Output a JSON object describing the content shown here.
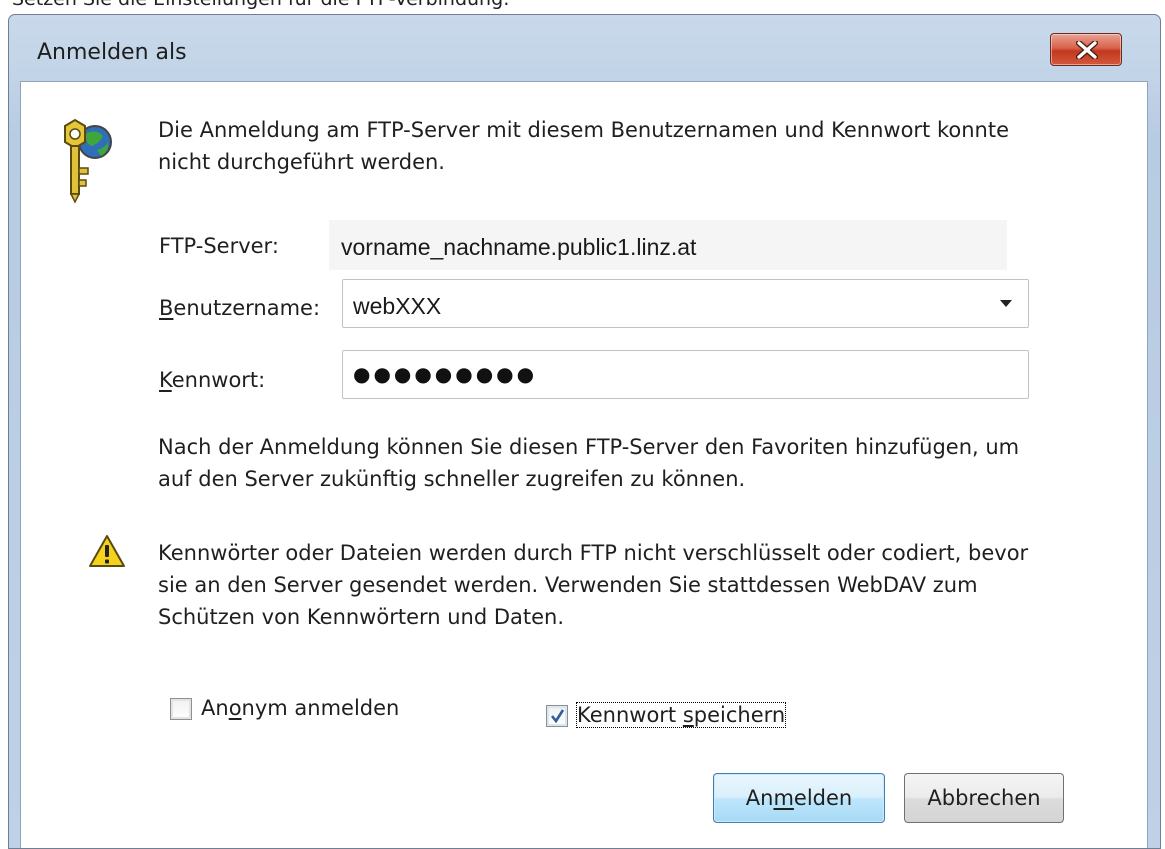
{
  "window": {
    "title": "Anmelden als",
    "caption_above": "Setzen Sie die Einstellungen für die FTP-Verbindung:"
  },
  "message": {
    "line1": "Die Anmeldung am FTP-Server mit diesem Benutzernamen und Kennwort konnte",
    "line2": "nicht durchgeführt werden."
  },
  "form": {
    "server_label": "FTP-Server:",
    "server_value": "vorname_nachname.public1.linz.at",
    "username_label_accel": "B",
    "username_label_rest": "enutzername:",
    "username_value": "webXXX",
    "password_label_accel": "K",
    "password_label_rest": "ennwort:",
    "password_masked": "●●●●●●●●●"
  },
  "info": {
    "line1": "Nach der Anmeldung können Sie diesen FTP-Server den Favoriten hinzufügen, um",
    "line2": "auf den Server zukünftig schneller zugreifen zu können."
  },
  "warning": {
    "line1": "Kennwörter oder Dateien werden durch FTP nicht verschlüsselt oder codiert, bevor",
    "line2": "sie an den Server gesendet werden. Verwenden Sie stattdessen WebDAV zum",
    "line3": "Schützen von Kennwörtern und Daten."
  },
  "options": {
    "anonymous_pre": "An",
    "anonymous_accel": "o",
    "anonymous_post": "nym anmelden",
    "anonymous_checked": false,
    "save_pre": "Kennwort ",
    "save_accel": "s",
    "save_post": "peichern",
    "save_checked": true
  },
  "buttons": {
    "login_pre": "An",
    "login_accel": "m",
    "login_post": "elden",
    "cancel": "Abbrechen"
  },
  "icons": {
    "dialog": "keys-globe-icon",
    "warning": "warning-icon",
    "close": "close-icon",
    "dropdown": "chevron-down-icon",
    "check": "checkmark-icon"
  },
  "colors": {
    "close_button": "#c1381f",
    "default_button_border": "#3c7fb1",
    "warning_yellow": "#f5d21b"
  }
}
